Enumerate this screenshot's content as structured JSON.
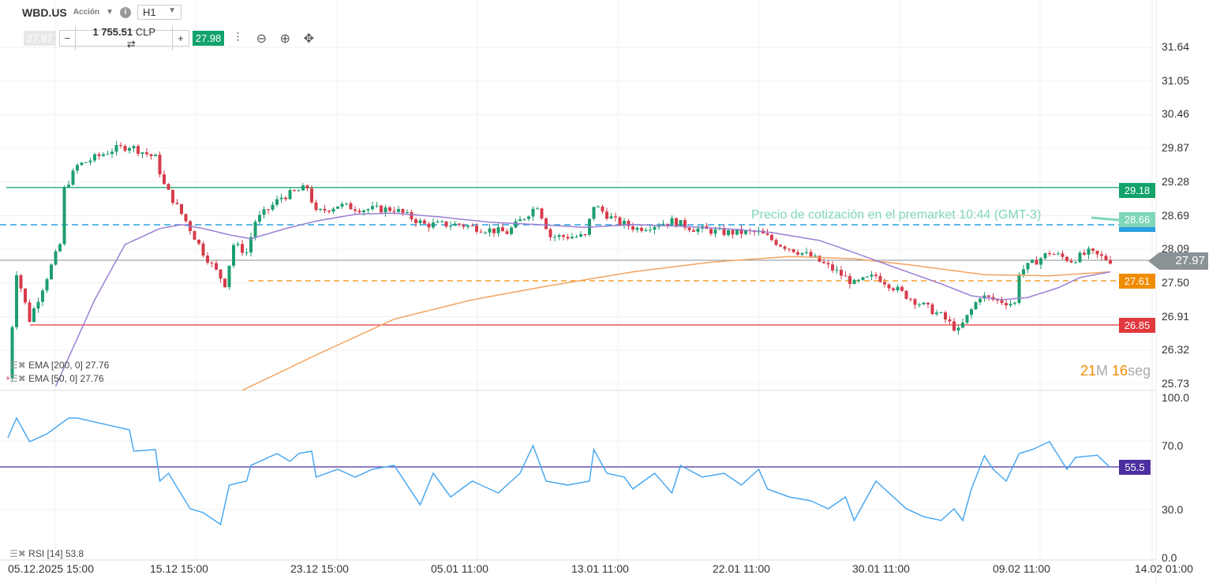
{
  "header": {
    "symbol": "WBD.US",
    "type": "Acción",
    "timeframe": "H1",
    "bid": "27.97",
    "ask": "27.98",
    "quantity": "1 755.51",
    "currency": "CLP",
    "minus": "−",
    "plus": "+",
    "swap_icon": "⇄"
  },
  "icons": {
    "info": "i",
    "candles": "candles-icon",
    "zoom_out": "zoom-out-icon",
    "zoom_in": "zoom-in-icon",
    "move": "move-icon"
  },
  "price_axis": [
    "31.64",
    "31.05",
    "30.46",
    "29.87",
    "29.28",
    "28.69",
    "28.09",
    "27.50",
    "26.91",
    "26.32",
    "25.73"
  ],
  "rsi_axis": [
    "100.0",
    "70.0",
    "30.0",
    "0.0"
  ],
  "time_axis": [
    "05.12.2025 15:00",
    "15.12 15:00",
    "23.12 15:00",
    "05.01 11:00",
    "13.01 11:00",
    "22.01 11:00",
    "30.01 11:00",
    "09.02 11:00",
    "14.02 01:00"
  ],
  "levels": {
    "resistance": "29.18",
    "premarket": "28.66",
    "current": "27.97",
    "orange": "27.61",
    "support": "26.85",
    "rsi": "55.5"
  },
  "premarket_text": "Precio de cotización en el premarket 10:44 (GMT-3)",
  "countdown": {
    "min": "21",
    "min_unit": "M",
    "sec": "16",
    "sec_unit": "seg"
  },
  "legends": {
    "ema200": "EMA [200, 0] 27.76",
    "ema50": "EMA [50, 0] 27.76",
    "rsi": "RSI [14] 53.8"
  },
  "colors": {
    "up": "#1e9e6f",
    "down": "#d63c4b",
    "ema50": "#9b7fd4",
    "ema200": "#f4a460",
    "rsi": "#4aa8f0",
    "resistance": "#13a36b",
    "support": "#e0393e",
    "orange": "#f08c00",
    "premarket": "#7fd6b8",
    "blue": "#2aa0e0",
    "rsi_level": "#4b2fa0"
  },
  "chart_data": {
    "type": "candlestick",
    "ylim": [
      25.73,
      31.64
    ],
    "rsi_ylim": [
      0,
      100
    ],
    "n": 255,
    "close_path": [
      [
        0,
        25.83
      ],
      [
        2,
        27.7
      ],
      [
        5,
        26.86
      ],
      [
        12,
        28.18
      ],
      [
        13,
        29.15
      ],
      [
        16,
        29.56
      ],
      [
        24,
        29.84
      ],
      [
        28,
        29.91
      ],
      [
        34,
        29.7
      ],
      [
        36,
        29.22
      ],
      [
        41,
        28.59
      ],
      [
        45,
        28.04
      ],
      [
        50,
        27.49
      ],
      [
        52,
        28.18
      ],
      [
        55,
        28.04
      ],
      [
        57,
        28.59
      ],
      [
        63,
        29.01
      ],
      [
        69,
        29.18
      ],
      [
        71,
        28.73
      ],
      [
        76,
        28.87
      ],
      [
        82,
        28.8
      ],
      [
        89,
        28.8
      ],
      [
        96,
        28.53
      ],
      [
        104,
        28.53
      ],
      [
        109,
        28.46
      ],
      [
        115,
        28.39
      ],
      [
        122,
        28.87
      ],
      [
        125,
        28.32
      ],
      [
        133,
        28.32
      ],
      [
        135,
        28.87
      ],
      [
        140,
        28.59
      ],
      [
        145,
        28.46
      ],
      [
        153,
        28.59
      ],
      [
        158,
        28.46
      ],
      [
        165,
        28.39
      ],
      [
        173,
        28.39
      ],
      [
        178,
        28.18
      ],
      [
        185,
        27.97
      ],
      [
        191,
        27.7
      ],
      [
        195,
        27.49
      ],
      [
        200,
        27.63
      ],
      [
        207,
        27.28
      ],
      [
        215,
        26.93
      ],
      [
        219,
        26.66
      ],
      [
        224,
        27.28
      ],
      [
        227,
        27.21
      ],
      [
        232,
        27.14
      ],
      [
        233,
        27.7
      ],
      [
        240,
        28.04
      ],
      [
        245,
        27.9
      ],
      [
        249,
        28.04
      ],
      [
        254,
        27.9
      ]
    ],
    "ema50": [
      [
        11,
        25.69
      ],
      [
        20,
        27.21
      ],
      [
        27,
        28.18
      ],
      [
        35,
        28.46
      ],
      [
        40,
        28.53
      ],
      [
        45,
        28.46
      ],
      [
        51,
        28.35
      ],
      [
        56,
        28.28
      ],
      [
        64,
        28.46
      ],
      [
        71,
        28.59
      ],
      [
        80,
        28.71
      ],
      [
        89,
        28.73
      ],
      [
        100,
        28.66
      ],
      [
        111,
        28.57
      ],
      [
        122,
        28.53
      ],
      [
        133,
        28.48
      ],
      [
        144,
        28.53
      ],
      [
        155,
        28.5
      ],
      [
        165,
        28.46
      ],
      [
        176,
        28.39
      ],
      [
        187,
        28.25
      ],
      [
        196,
        28.01
      ],
      [
        205,
        27.76
      ],
      [
        215,
        27.49
      ],
      [
        222,
        27.28
      ],
      [
        229,
        27.21
      ],
      [
        235,
        27.25
      ],
      [
        242,
        27.42
      ],
      [
        247,
        27.6
      ],
      [
        254,
        27.7
      ]
    ],
    "ema200": [
      [
        54,
        25.62
      ],
      [
        71,
        26.24
      ],
      [
        89,
        26.87
      ],
      [
        107,
        27.21
      ],
      [
        125,
        27.46
      ],
      [
        144,
        27.7
      ],
      [
        162,
        27.87
      ],
      [
        180,
        27.97
      ],
      [
        195,
        27.93
      ],
      [
        207,
        27.83
      ],
      [
        225,
        27.65
      ],
      [
        240,
        27.63
      ],
      [
        254,
        27.7
      ]
    ],
    "rsi": [
      [
        0,
        74.4
      ],
      [
        2,
        86.7
      ],
      [
        5,
        71.9
      ],
      [
        9,
        76.8
      ],
      [
        14,
        86.7
      ],
      [
        16,
        86.7
      ],
      [
        28,
        79.3
      ],
      [
        29,
        66
      ],
      [
        34,
        67
      ],
      [
        35,
        47.3
      ],
      [
        37,
        52.2
      ],
      [
        42,
        30
      ],
      [
        45,
        27.6
      ],
      [
        49,
        20.2
      ],
      [
        51,
        44.8
      ],
      [
        55,
        47.3
      ],
      [
        56,
        57.1
      ],
      [
        62,
        64.5
      ],
      [
        65,
        59.6
      ],
      [
        67,
        64.5
      ],
      [
        70,
        66
      ],
      [
        71,
        49.8
      ],
      [
        76,
        54.7
      ],
      [
        80,
        49.8
      ],
      [
        84,
        54.7
      ],
      [
        89,
        57.1
      ],
      [
        95,
        32.5
      ],
      [
        98,
        52.2
      ],
      [
        102,
        37.4
      ],
      [
        107,
        47.3
      ],
      [
        113,
        39.9
      ],
      [
        118,
        52.2
      ],
      [
        121,
        69.5
      ],
      [
        124,
        47.3
      ],
      [
        129,
        44.8
      ],
      [
        134,
        47.3
      ],
      [
        135,
        67
      ],
      [
        138,
        52.2
      ],
      [
        142,
        49.8
      ],
      [
        144,
        42.4
      ],
      [
        149,
        52.2
      ],
      [
        153,
        39.9
      ],
      [
        155,
        57.1
      ],
      [
        160,
        49.8
      ],
      [
        165,
        52.2
      ],
      [
        169,
        44.8
      ],
      [
        173,
        54.7
      ],
      [
        175,
        42.4
      ],
      [
        180,
        37.4
      ],
      [
        185,
        35
      ],
      [
        189,
        30
      ],
      [
        193,
        37.4
      ],
      [
        195,
        22.7
      ],
      [
        200,
        47.3
      ],
      [
        204,
        37.4
      ],
      [
        207,
        30
      ],
      [
        211,
        25.1
      ],
      [
        215,
        22.7
      ],
      [
        218,
        30
      ],
      [
        220,
        22.7
      ],
      [
        222,
        42.4
      ],
      [
        225,
        63.1
      ],
      [
        227,
        54.7
      ],
      [
        230,
        47.3
      ],
      [
        233,
        64.5
      ],
      [
        236,
        67
      ],
      [
        240,
        71.9
      ],
      [
        244,
        54.7
      ],
      [
        246,
        62.1
      ],
      [
        251,
        63.5
      ],
      [
        254,
        55.7
      ]
    ]
  }
}
